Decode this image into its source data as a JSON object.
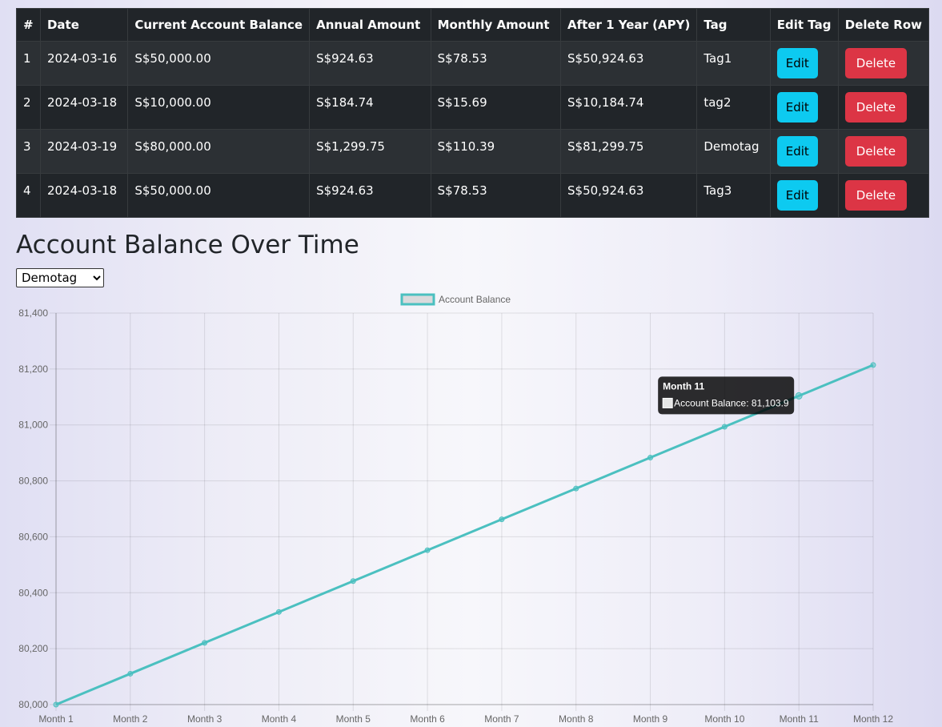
{
  "table": {
    "headers": [
      "#",
      "Date",
      "Current Account Balance",
      "Annual Amount",
      "Monthly Amount",
      "After 1 Year (APY)",
      "Tag",
      "Edit Tag",
      "Delete Row"
    ],
    "rows": [
      {
        "num": "1",
        "date": "2024-03-16",
        "balance": "S$50,000.00",
        "annual": "S$924.63",
        "monthly": "S$78.53",
        "after": "S$50,924.63",
        "tag": "Tag1",
        "edit": "Edit",
        "delete": "Delete"
      },
      {
        "num": "2",
        "date": "2024-03-18",
        "balance": "S$10,000.00",
        "annual": "S$184.74",
        "monthly": "S$15.69",
        "after": "S$10,184.74",
        "tag": "tag2",
        "edit": "Edit",
        "delete": "Delete"
      },
      {
        "num": "3",
        "date": "2024-03-19",
        "balance": "S$80,000.00",
        "annual": "S$1,299.75",
        "monthly": "S$110.39",
        "after": "S$81,299.75",
        "tag": "Demotag",
        "edit": "Edit",
        "delete": "Delete"
      },
      {
        "num": "4",
        "date": "2024-03-18",
        "balance": "S$50,000.00",
        "annual": "S$924.63",
        "monthly": "S$78.53",
        "after": "S$50,924.63",
        "tag": "Tag3",
        "edit": "Edit",
        "delete": "Delete"
      }
    ]
  },
  "section_title": "Account Balance Over Time",
  "tag_select": {
    "selected": "Demotag",
    "options": [
      "Demotag"
    ]
  },
  "colors": {
    "line": "#4bc0c0",
    "edit_button": "#0dcaf0",
    "delete_button": "#dc3545",
    "table_bg": "#212529"
  },
  "tooltip": {
    "title": "Month 11",
    "label": "Account Balance: 81,103.9"
  },
  "chart_data": {
    "type": "line",
    "categories": [
      "Month 1",
      "Month 2",
      "Month 3",
      "Month 4",
      "Month 5",
      "Month 6",
      "Month 7",
      "Month 8",
      "Month 9",
      "Month 10",
      "Month 11",
      "Month 12"
    ],
    "series": [
      {
        "name": "Account Balance",
        "values": [
          80000,
          80110.39,
          80220.78,
          80331.17,
          80441.56,
          80551.95,
          80662.34,
          80772.73,
          80883.12,
          80993.51,
          81103.9,
          81214.29
        ]
      }
    ],
    "yticks": [
      "80,000",
      "80,200",
      "80,400",
      "80,600",
      "80,800",
      "81,000",
      "81,200",
      "81,400"
    ],
    "ylim": [
      80000,
      81400
    ],
    "legend": "top",
    "grid": true,
    "active_point": "Month 11"
  }
}
